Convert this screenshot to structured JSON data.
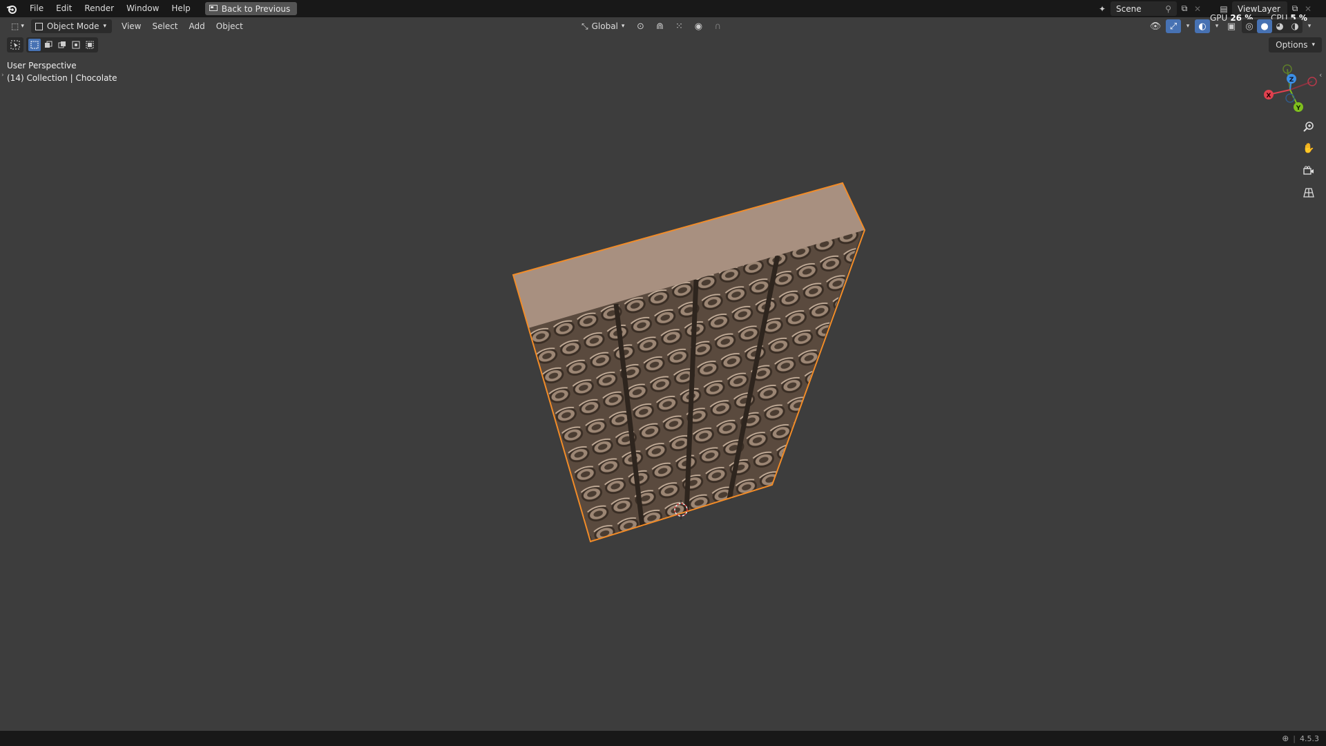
{
  "menubar": {
    "items": [
      "File",
      "Edit",
      "Render",
      "Window",
      "Help"
    ],
    "back_button": "Back to Previous",
    "scene": "Scene",
    "view_layer": "ViewLayer"
  },
  "perf": {
    "gpu_label": "GPU",
    "gpu_value": "26 %",
    "cpu_label": "CPU",
    "cpu_value": "5 %"
  },
  "header": {
    "mode": "Object Mode",
    "menus": [
      "View",
      "Select",
      "Add",
      "Object"
    ],
    "orientation": "Global"
  },
  "options_label": "Options",
  "viewport": {
    "perspective": "User Perspective",
    "collection": "(14) Collection | Chocolate"
  },
  "gizmo": {
    "x": "X",
    "y": "Y",
    "z": "Z"
  },
  "status": {
    "version": "4.5.3"
  },
  "colors": {
    "selection_outline": "#f28c28",
    "object_top": "#a89080",
    "axis_x": "#e0414f",
    "axis_y": "#7fbf1e",
    "axis_z": "#3b8fe6"
  }
}
